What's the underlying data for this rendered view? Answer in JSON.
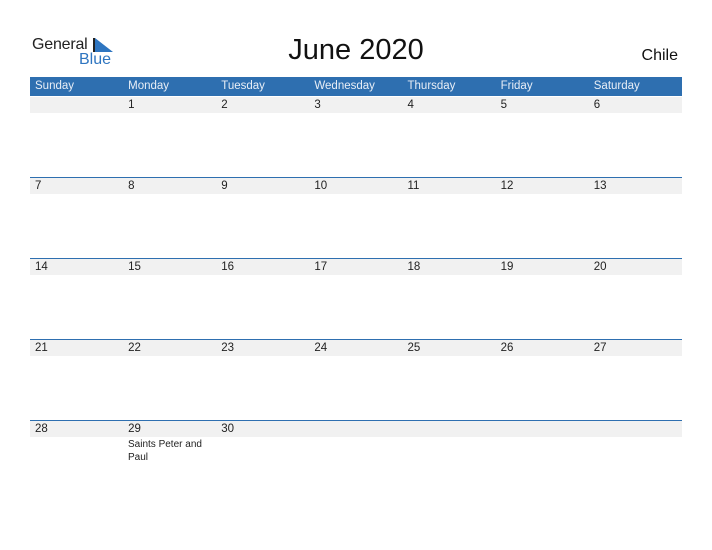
{
  "logo": {
    "line1": "General",
    "line2": "Blue",
    "icon": "blue-triangle-icon"
  },
  "title": "June 2020",
  "country": "Chile",
  "days": [
    "Sunday",
    "Monday",
    "Tuesday",
    "Wednesday",
    "Thursday",
    "Friday",
    "Saturday"
  ],
  "weeks": [
    [
      "",
      "1",
      "2",
      "3",
      "4",
      "5",
      "6"
    ],
    [
      "7",
      "8",
      "9",
      "10",
      "11",
      "12",
      "13"
    ],
    [
      "14",
      "15",
      "16",
      "17",
      "18",
      "19",
      "20"
    ],
    [
      "21",
      "22",
      "23",
      "24",
      "25",
      "26",
      "27"
    ],
    [
      "28",
      "29",
      "30",
      "",
      "",
      "",
      ""
    ]
  ],
  "holidays": [
    {
      "date": "29",
      "name": "Saints Peter and Paul"
    }
  ],
  "colors": {
    "accent": "#2e6fb0",
    "band": "#f1f1f1"
  }
}
